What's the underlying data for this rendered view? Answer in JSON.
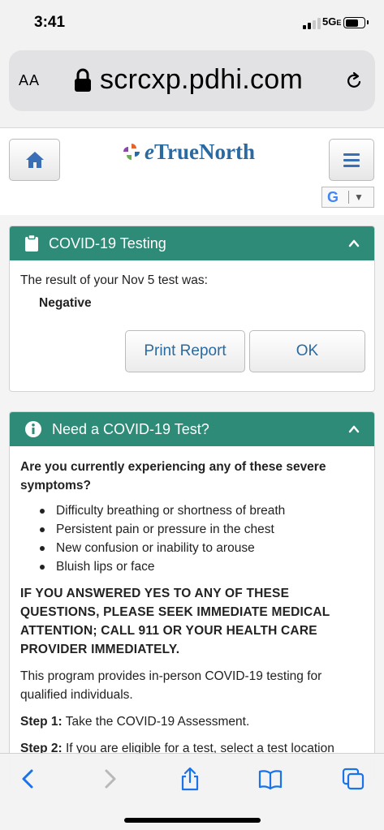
{
  "status_bar": {
    "time": "3:41",
    "network": "5G",
    "network_suffix": "E"
  },
  "browser": {
    "text_size_label": "AA",
    "url": "scrcxp.pdhi.com",
    "icons": [
      "lock-icon",
      "reload-icon"
    ]
  },
  "site_header": {
    "logo_prefix": "e",
    "logo_name": "TrueNorth",
    "brand_color": "#2b6aa0",
    "translate_letter": "G",
    "translate_arrow": "▼"
  },
  "testing_panel": {
    "title": "COVID-19 Testing",
    "result_text": "The result of your Nov 5 test was:",
    "result_value": "Negative",
    "print_button": "Print Report",
    "ok_button": "OK",
    "header_color": "#2e8b78"
  },
  "need_test_panel": {
    "title": "Need a COVID-19 Test?",
    "question": "Are you currently experiencing any of these severe symptoms?",
    "symptoms": [
      "Difficulty breathing or shortness of breath",
      "Persistent pain or pressure in the chest",
      "New confusion or inability to arouse",
      "Bluish lips or face"
    ],
    "warning": "IF YOU ANSWERED YES TO ANY OF THESE QUESTIONS, PLEASE SEEK IMMEDIATE MEDICAL ATTENTION; CALL 911 OR YOUR HEALTH CARE PROVIDER IMMEDIATELY.",
    "program_text": "This program provides in-person COVID-19 testing for qualified individuals.",
    "step1_label": "Step 1:",
    "step1_text": " Take the COVID-19 Assessment.",
    "step2_label": "Step 2:",
    "step2_text": " If you are eligible for a test, select a test location"
  },
  "toolbar": {
    "icons": [
      "back-icon",
      "forward-icon",
      "share-icon",
      "bookmarks-icon",
      "tabs-icon"
    ]
  }
}
